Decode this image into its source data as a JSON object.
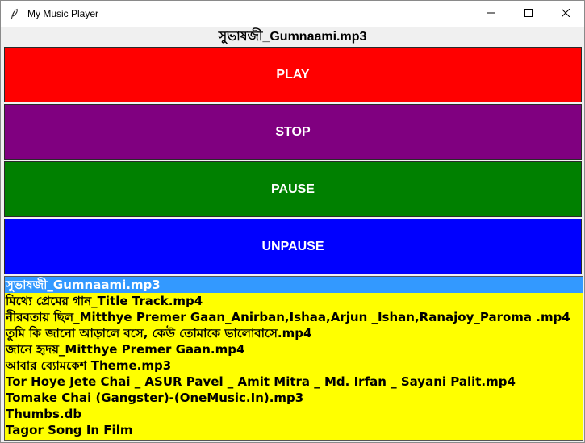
{
  "window": {
    "title": "My Music Player"
  },
  "now_playing": {
    "label": "সুভাষজী_Gumnaami.mp3"
  },
  "controls": {
    "play": {
      "label": "PLAY",
      "color": "#ff0000"
    },
    "stop": {
      "label": "STOP",
      "color": "#800080"
    },
    "pause": {
      "label": "PAUSE",
      "color": "#008000"
    },
    "unpause": {
      "label": "UNPAUSE",
      "color": "#0000ff"
    }
  },
  "playlist": {
    "background": "#ffff00",
    "selected_color": "#3399ff",
    "selected_index": 0,
    "items": [
      "সুভাষজী_Gumnaami.mp3",
      "মিথ্যে প্রেমের গান_Title Track.mp4",
      "নীরবতায় ছিল_Mitthye Premer Gaan_Anirban,Ishaa,Arjun _Ishan,Ranajoy_Paroma .mp4",
      "তুমি কি জানো আড়ালে বসে, কেউ তোমাকে ভালোবাসে.mp4",
      "জানে হৃদয়_Mitthye Premer Gaan.mp4",
      "আবার ব্যোমকেশ Theme.mp3",
      "Tor Hoye Jete Chai _ ASUR Pavel _ Amit Mitra _ Md. Irfan _ Sayani Palit.mp4",
      "Tomake Chai (Gangster)-(OneMusic.In).mp3",
      "Thumbs.db",
      "Tagor Song In Film"
    ]
  },
  "icons": {
    "app": "feather-icon",
    "minimize": "minimize-icon",
    "maximize": "maximize-icon",
    "close": "close-icon"
  }
}
